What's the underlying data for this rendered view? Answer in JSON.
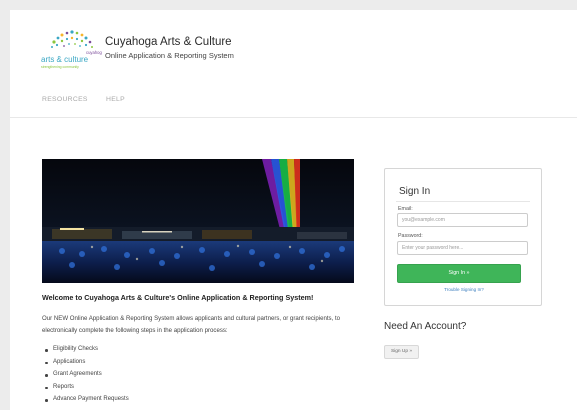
{
  "brand": {
    "logo_text_top": "cuyahoga",
    "logo_text_main": "arts & culture",
    "logo_text_tag": "strengthening community",
    "title": "Cuyahoga Arts & Culture",
    "subtitle": "Online Application & Reporting System"
  },
  "nav": {
    "resources": "RESOURCES",
    "help": "HELP"
  },
  "main": {
    "welcome": "Welcome to Cuyahoga Arts & Culture's Online Application & Reporting System!",
    "intro": "Our NEW Online Application & Reporting System allows applicants and cultural partners, or grant recipients, to electronically complete the following steps in the application process:",
    "steps": [
      "Eligibility Checks",
      "Applications",
      "Grant Agreements",
      "Reports",
      "Advance Payment Requests"
    ]
  },
  "signin": {
    "title": "Sign In",
    "email_label": "Email:",
    "email_placeholder": "you@example.com",
    "password_label": "Password:",
    "password_placeholder": "Enter your password here...",
    "button": "Sign In »",
    "trouble_link": "Trouble Signing In?"
  },
  "account": {
    "title": "Need An Account?",
    "signup_button": "Sign Up »"
  },
  "colors": {
    "accent_green": "#3fb559",
    "link_blue": "#3d7fbf",
    "logo_teal": "#3aa7c4",
    "logo_green": "#8cc63f",
    "logo_purple": "#7a4a9a"
  }
}
